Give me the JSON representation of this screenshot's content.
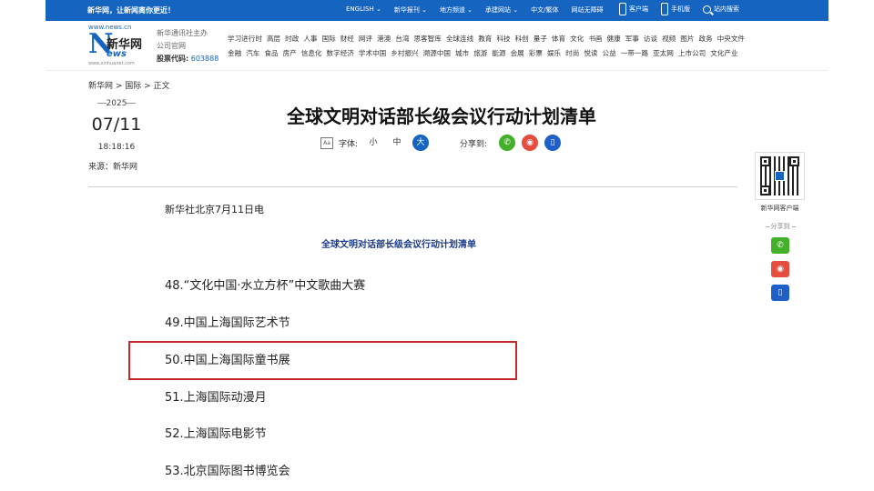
{
  "topbar": {
    "slogan": "新华网，让新闻离你更近！",
    "links": [
      "ENGLISH ⌄",
      "新华报刊 ⌄",
      "地方频道 ⌄",
      "承建网站 ⌄",
      "中文/繁体",
      "网站无障碍"
    ],
    "apps": [
      "客户端",
      "手机版",
      "站内搜索"
    ]
  },
  "logo": {
    "url": "www.news.cn",
    "n": "N",
    "cn": "新华网",
    "ews": "ews",
    "sub": "www.xinhuanet.com"
  },
  "sponsor": {
    "line1": "新华通讯社主办",
    "line2": "公司官网",
    "stock_label": "股票代码:",
    "stock_code": "603888"
  },
  "channels": {
    "row1": [
      "学习进行时",
      "高层",
      "时政",
      "人事",
      "国际",
      "财经",
      "网评",
      "港澳",
      "台湾",
      "思客智库",
      "全球连线",
      "教育",
      "科技",
      "科创",
      "量子",
      "体育",
      "文化",
      "书画",
      "健康",
      "军事",
      "访谈",
      "视频",
      "图片",
      "政务",
      "中央文件"
    ],
    "row2": [
      "金融",
      "汽车",
      "食品",
      "房产",
      "信息化",
      "数字经济",
      "学术中国",
      "乡村振兴",
      "溯源中国",
      "城市",
      "旅游",
      "能源",
      "会展",
      "彩票",
      "娱乐",
      "时尚",
      "悦读",
      "公益",
      "一带一路",
      "亚太网",
      "上市公司",
      "文化产业"
    ]
  },
  "breadcrumb": "新华网 > 国际 > 正文",
  "date": {
    "year": "2025",
    "md": "07/11",
    "time": "18:18:16"
  },
  "source": "来源：新华网",
  "article": {
    "title": "全球文明对话部长级会议行动计划清单",
    "font_label": "字体:",
    "font_icon": "Aa",
    "sizes": [
      "小",
      "中",
      "大"
    ],
    "share_label": "分享到:",
    "lead": "新华社北京7月11日电",
    "subtitle": "全球文明对话部长级会议行动计划清单",
    "items": [
      "48.“文化中国·水立方杯”中文歌曲大赛",
      "49.中国上海国际艺术节",
      "50.中国上海国际童书展",
      "51.上海国际动漫月",
      "52.上海国际电影节",
      "53.北京国际图书博览会"
    ]
  },
  "side": {
    "qr_label": "新华网客户端",
    "share_label": "分享到"
  },
  "colors": {
    "brand": "#1565c0",
    "highlight": "#c62828",
    "wechat": "#43b02a",
    "weibo": "#e54d3f",
    "mobile": "#1e60c8"
  }
}
